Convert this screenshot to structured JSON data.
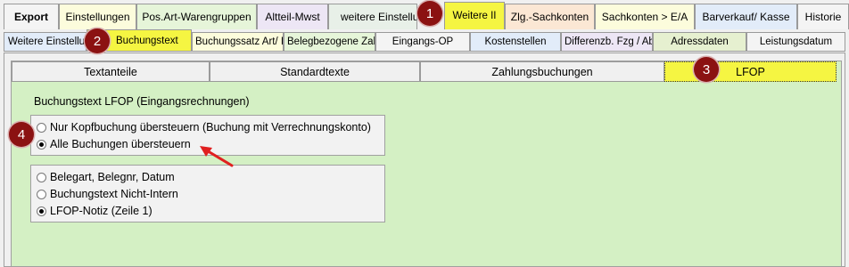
{
  "top_tabs": [
    {
      "label": "Export",
      "bold": true
    },
    {
      "label": "Einstellungen"
    },
    {
      "label": "Pos.Art-Warengruppen"
    },
    {
      "label": "Altteil-Mwst"
    },
    {
      "label": "weitere Einstellun"
    },
    {
      "label": "Weitere II",
      "active": true
    },
    {
      "label": "Zlg.-Sachkonten"
    },
    {
      "label": "Sachkonten > E/A"
    },
    {
      "label": "Barverkauf/ Kasse"
    },
    {
      "label": "Historie"
    }
  ],
  "second_tabs": [
    {
      "label": "Weitere Einstellu"
    },
    {
      "label": "Buchungstext",
      "active": true
    },
    {
      "label": "Buchungssatz Art/ Ir"
    },
    {
      "label": "Belegbezogene Zah"
    },
    {
      "label": "Eingangs-OP"
    },
    {
      "label": "Kostenstellen"
    },
    {
      "label": "Differenzb. Fzg / Ab"
    },
    {
      "label": "Adressdaten"
    },
    {
      "label": "Leistungsdatum"
    }
  ],
  "sub_tabs": [
    {
      "label": "Textanteile"
    },
    {
      "label": "Standardtexte"
    },
    {
      "label": "Zahlungsbuchungen"
    },
    {
      "label": "LFOP",
      "active": true
    }
  ],
  "section_title": "Buchungstext LFOP (Eingangsrechnungen)",
  "group1": [
    {
      "label": "Nur Kopfbuchung übersteuern (Buchung mit Verrechnungskonto)",
      "checked": false
    },
    {
      "label": "Alle Buchungen übersteuern",
      "checked": true
    }
  ],
  "group2": [
    {
      "label": "Belegart, Belegnr, Datum",
      "checked": false
    },
    {
      "label": "Buchungstext Nicht-Intern",
      "checked": false
    },
    {
      "label": "LFOP-Notiz (Zeile 1)",
      "checked": true
    }
  ],
  "callouts": [
    "1",
    "2",
    "3",
    "4"
  ],
  "colors": {
    "active_tab": "#f5f542",
    "pale_yellow_tab": "#fcfcd9",
    "pale_green_tab": "#e6f5d9",
    "pale_blue_tab": "#e2ecf9",
    "pale_purple_tab": "#ede6f5",
    "pale_orange_tab": "#fbe7d4",
    "panel_green": "#d4f0c4",
    "callout": "#8b1212",
    "arrow": "#e02020"
  }
}
